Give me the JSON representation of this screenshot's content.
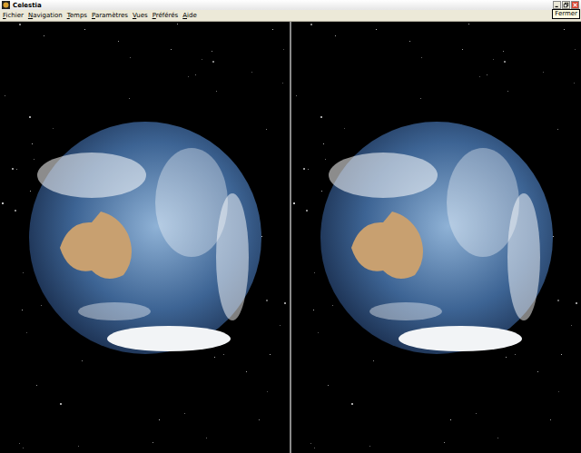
{
  "window": {
    "title": "Celestia"
  },
  "window_buttons": [
    {
      "name": "minimize"
    },
    {
      "name": "maximize"
    },
    {
      "name": "close"
    }
  ],
  "tooltip": {
    "text": "Fermer"
  },
  "menu": [
    "Fichier",
    "Navigation",
    "Temps",
    "Paramètres",
    "Vues",
    "Préférés",
    "Aide"
  ],
  "views": [
    {
      "name": "left-eye"
    },
    {
      "name": "right-eye"
    }
  ]
}
